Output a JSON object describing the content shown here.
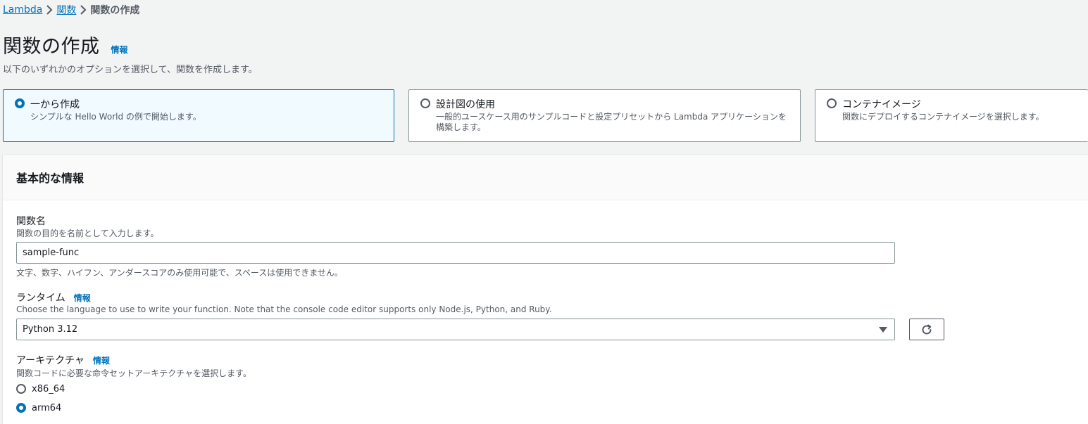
{
  "breadcrumb": {
    "root": "Lambda",
    "functions": "関数",
    "current": "関数の作成"
  },
  "header": {
    "title": "関数の作成",
    "info": "情報",
    "description": "以下のいずれかのオプションを選択して、関数を作成します。"
  },
  "options": [
    {
      "title": "一から作成",
      "description": "シンプルな Hello World の例で開始します。",
      "selected": true
    },
    {
      "title": "設計図の使用",
      "description_line1": "一般的ユースケース用のサンプルコードと設定プリセットから Lambda アプリケーションを",
      "description_line2": "構築します。",
      "selected": false
    },
    {
      "title": "コンテナイメージ",
      "description": "関数にデプロイするコンテナイメージを選択します。",
      "selected": false
    }
  ],
  "basic_info": {
    "title": "基本的な情報",
    "function_name": {
      "label": "関数名",
      "description": "関数の目的を名前として入力します。",
      "value": "sample-func",
      "constraint": "文字、数字、ハイフン、アンダースコアのみ使用可能で、スペースは使用できません。"
    },
    "runtime": {
      "label": "ランタイム",
      "info": "情報",
      "description": "Choose the language to use to write your function. Note that the console code editor supports only Node.js, Python, and Ruby.",
      "value": "Python 3.12"
    },
    "architecture": {
      "label": "アーキテクチャ",
      "info": "情報",
      "description": "関数コードに必要な命令セットアーキテクチャを選択します。",
      "options": [
        {
          "label": "x86_64",
          "selected": false
        },
        {
          "label": "arm64",
          "selected": true
        }
      ]
    }
  },
  "colors": {
    "link": "#0073bb",
    "selected_bg": "#f1faff",
    "text": "#16191f",
    "secondary_text": "#545b64"
  }
}
